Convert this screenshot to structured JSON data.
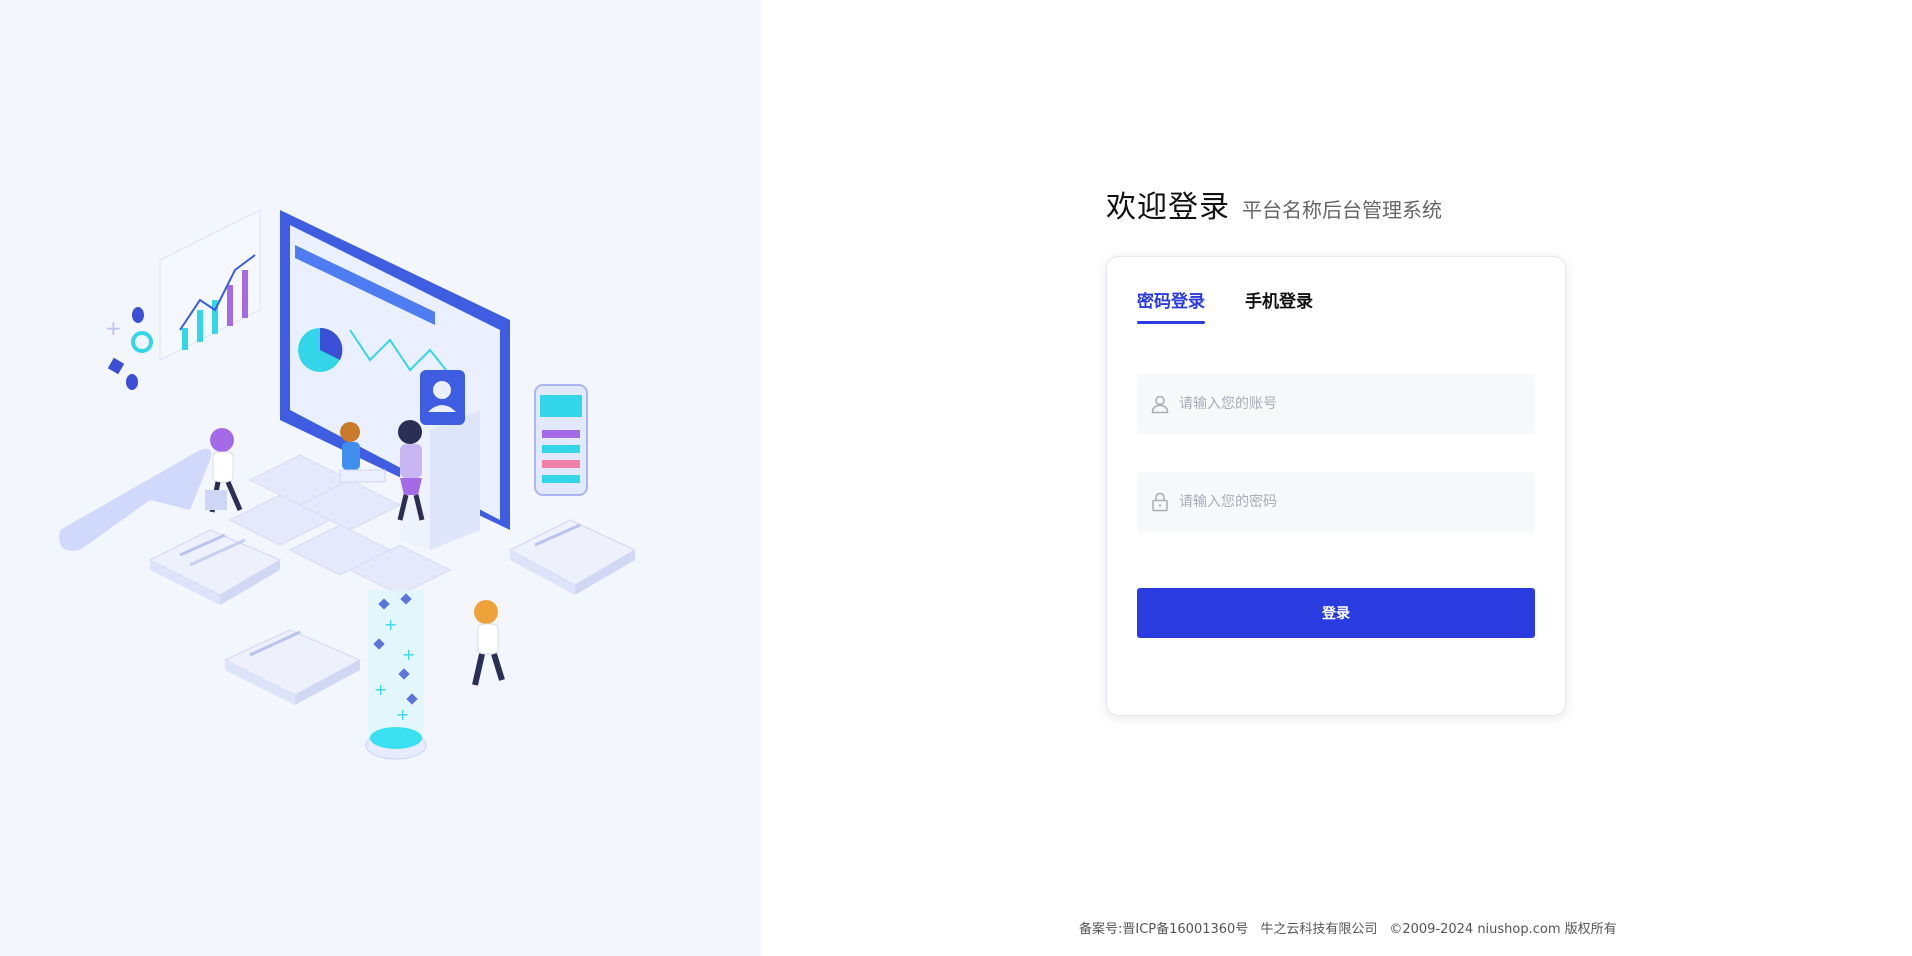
{
  "welcome": {
    "title": "欢迎登录",
    "subtitle": "平台名称后台管理系统"
  },
  "login": {
    "tabs": [
      {
        "label": "密码登录",
        "active": true
      },
      {
        "label": "手机登录",
        "active": false
      }
    ],
    "account_placeholder": "请输入您的账号",
    "account_icon": "user-icon",
    "password_placeholder": "请输入您的密码",
    "password_icon": "lock-icon",
    "submit_label": "登录"
  },
  "footer": {
    "icp": "备案号:晋ICP备16001360号",
    "company": "牛之云科技有限公司",
    "copyright": "©2009-2024 niushop.com 版权所有"
  },
  "colors": {
    "accent": "#2a3be0",
    "left_panel_bg": "#f4f6fd",
    "field_bg": "#f7f8fa"
  }
}
